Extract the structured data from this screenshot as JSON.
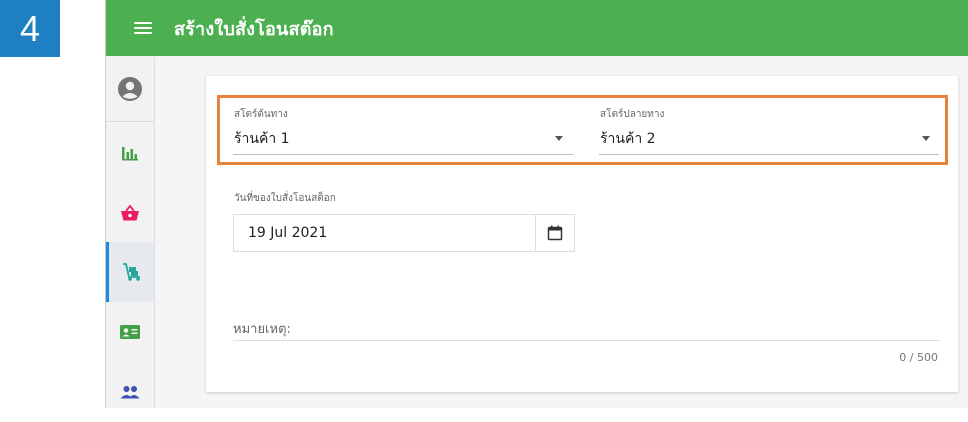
{
  "step": {
    "number": "4"
  },
  "header": {
    "title": "สร้างใบสั่งโอนสต๊อก",
    "menu_icon": "hamburger-menu-icon"
  },
  "sidebar": {
    "items": [
      {
        "icon": "user-profile-icon",
        "color": "#757575",
        "active": false
      },
      {
        "icon": "bar-chart-icon",
        "color": "#43a047",
        "active": false
      },
      {
        "icon": "shopping-basket-icon",
        "color": "#e91e63",
        "active": false
      },
      {
        "icon": "hand-truck-icon",
        "color": "#26a69a",
        "active": true
      },
      {
        "icon": "contact-card-icon",
        "color": "#43a047",
        "active": false
      },
      {
        "icon": "users-group-icon",
        "color": "#3f51b5",
        "active": false
      }
    ]
  },
  "form": {
    "source_store": {
      "label": "สโตร์ต้นทาง",
      "value": "ร้านค้า 1"
    },
    "destination_store": {
      "label": "สโตร์ปลายทาง",
      "value": "ร้านค้า 2"
    },
    "order_date": {
      "label": "วันที่ของใบสั่งโอนสต็อก",
      "value": "19 Jul 2021"
    },
    "note": {
      "label": "หมายเหตุ:",
      "counter": "0 / 500"
    }
  },
  "colors": {
    "header_bg": "#4caf50",
    "step_badge": "#1e7fc2",
    "highlight": "#e8833a",
    "active_indicator": "#1e88e5"
  }
}
